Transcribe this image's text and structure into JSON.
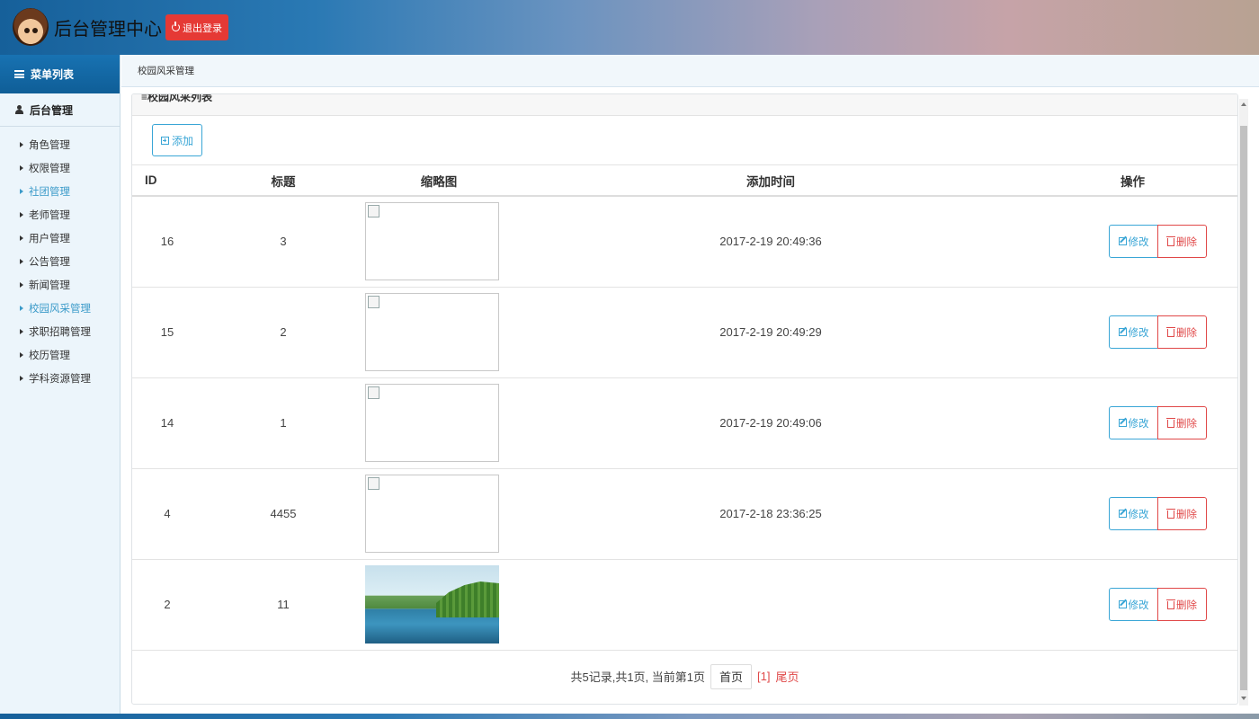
{
  "header": {
    "title": "后台管理中心",
    "logout_label": "退出登录"
  },
  "sidebar": {
    "menu_title": "菜单列表",
    "group_title": "后台管理",
    "items": [
      {
        "label": "角色管理",
        "active": false
      },
      {
        "label": "权限管理",
        "active": false
      },
      {
        "label": "社团管理",
        "active": true
      },
      {
        "label": "老师管理",
        "active": false
      },
      {
        "label": "用户管理",
        "active": false
      },
      {
        "label": "公告管理",
        "active": false
      },
      {
        "label": "新闻管理",
        "active": false
      },
      {
        "label": "校园风采管理",
        "active": true
      },
      {
        "label": "求职招聘管理",
        "active": false
      },
      {
        "label": "校历管理",
        "active": false
      },
      {
        "label": "学科资源管理",
        "active": false
      }
    ]
  },
  "breadcrumb": "校园风采管理",
  "panel": {
    "title": "≡校园风采列表",
    "add_label": "添加",
    "columns": [
      "ID",
      "标题",
      "缩略图",
      "添加时间",
      "操作"
    ],
    "rows": [
      {
        "id": "16",
        "title": "3",
        "time": "2017-2-19 20:49:36",
        "thumb": "broken"
      },
      {
        "id": "15",
        "title": "2",
        "time": "2017-2-19 20:49:29",
        "thumb": "broken"
      },
      {
        "id": "14",
        "title": "1",
        "time": "2017-2-19 20:49:06",
        "thumb": "broken"
      },
      {
        "id": "4",
        "title": "4455",
        "time": "2017-2-18 23:36:25",
        "thumb": "broken"
      },
      {
        "id": "2",
        "title": "11",
        "time": "",
        "thumb": "photo"
      }
    ],
    "edit_label": "修改",
    "delete_label": "删除"
  },
  "pager": {
    "summary": "共5记录,共1页, 当前第1页",
    "first_label": "首页",
    "current_page": "[1]",
    "last_label": "尾页"
  },
  "colors": {
    "accent": "#3aa6d6",
    "danger": "#e04848",
    "logout": "#e53935"
  }
}
